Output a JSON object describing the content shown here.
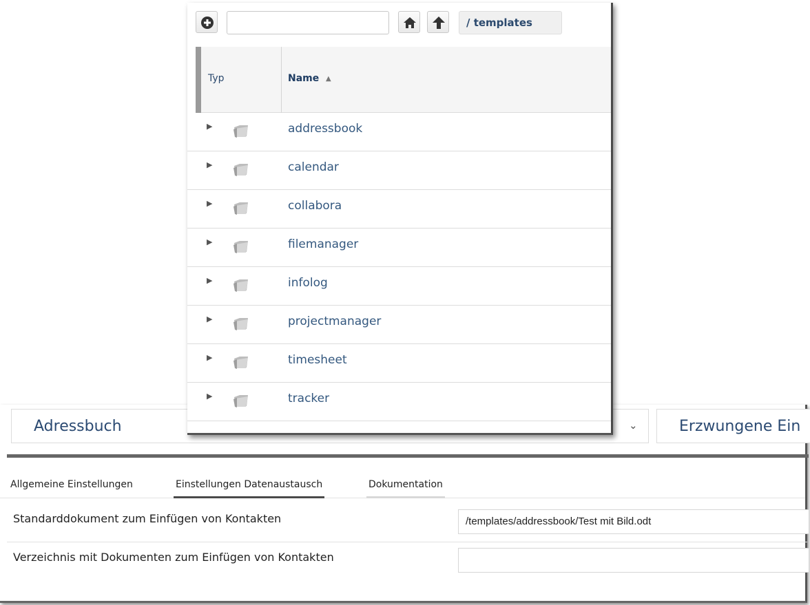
{
  "preferences": {
    "app_select": {
      "value": "Adressbuch"
    },
    "mode_select": {
      "value": "Erzwungene Ein"
    },
    "tabs": [
      {
        "label": "Allgemeine Einstellungen"
      },
      {
        "label": "Einstellungen Datenaustausch"
      },
      {
        "label": "Dokumentation"
      }
    ],
    "rows": [
      {
        "label": "Standarddokument zum Einfügen von Kontakten",
        "value": "/templates/addressbook/Test mit Bild.odt"
      },
      {
        "label": "Verzeichnis mit Dokumenten zum Einfügen von Kontakten",
        "value": ""
      }
    ]
  },
  "file_browser": {
    "search": {
      "value": ""
    },
    "path": "/ templates",
    "columns": {
      "type": "Typ",
      "name": "Name"
    },
    "items": [
      {
        "name": "addressbook"
      },
      {
        "name": "calendar"
      },
      {
        "name": "collabora"
      },
      {
        "name": "filemanager"
      },
      {
        "name": "infolog"
      },
      {
        "name": "projectmanager"
      },
      {
        "name": "timesheet"
      },
      {
        "name": "tracker"
      }
    ]
  }
}
